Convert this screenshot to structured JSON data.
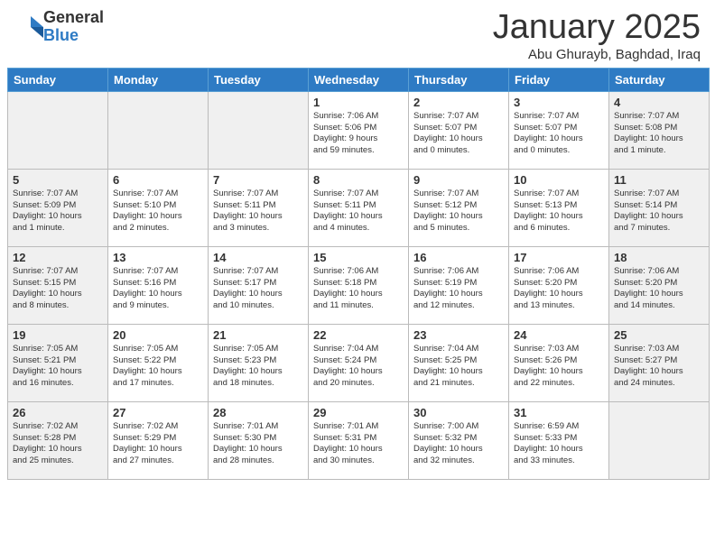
{
  "header": {
    "logo_general": "General",
    "logo_blue": "Blue",
    "month_title": "January 2025",
    "location": "Abu Ghurayb, Baghdad, Iraq"
  },
  "days_of_week": [
    "Sunday",
    "Monday",
    "Tuesday",
    "Wednesday",
    "Thursday",
    "Friday",
    "Saturday"
  ],
  "weeks": [
    [
      {
        "day": "",
        "info": ""
      },
      {
        "day": "",
        "info": ""
      },
      {
        "day": "",
        "info": ""
      },
      {
        "day": "1",
        "info": "Sunrise: 7:06 AM\nSunset: 5:06 PM\nDaylight: 9 hours\nand 59 minutes."
      },
      {
        "day": "2",
        "info": "Sunrise: 7:07 AM\nSunset: 5:07 PM\nDaylight: 10 hours\nand 0 minutes."
      },
      {
        "day": "3",
        "info": "Sunrise: 7:07 AM\nSunset: 5:07 PM\nDaylight: 10 hours\nand 0 minutes."
      },
      {
        "day": "4",
        "info": "Sunrise: 7:07 AM\nSunset: 5:08 PM\nDaylight: 10 hours\nand 1 minute."
      }
    ],
    [
      {
        "day": "5",
        "info": "Sunrise: 7:07 AM\nSunset: 5:09 PM\nDaylight: 10 hours\nand 1 minute."
      },
      {
        "day": "6",
        "info": "Sunrise: 7:07 AM\nSunset: 5:10 PM\nDaylight: 10 hours\nand 2 minutes."
      },
      {
        "day": "7",
        "info": "Sunrise: 7:07 AM\nSunset: 5:11 PM\nDaylight: 10 hours\nand 3 minutes."
      },
      {
        "day": "8",
        "info": "Sunrise: 7:07 AM\nSunset: 5:11 PM\nDaylight: 10 hours\nand 4 minutes."
      },
      {
        "day": "9",
        "info": "Sunrise: 7:07 AM\nSunset: 5:12 PM\nDaylight: 10 hours\nand 5 minutes."
      },
      {
        "day": "10",
        "info": "Sunrise: 7:07 AM\nSunset: 5:13 PM\nDaylight: 10 hours\nand 6 minutes."
      },
      {
        "day": "11",
        "info": "Sunrise: 7:07 AM\nSunset: 5:14 PM\nDaylight: 10 hours\nand 7 minutes."
      }
    ],
    [
      {
        "day": "12",
        "info": "Sunrise: 7:07 AM\nSunset: 5:15 PM\nDaylight: 10 hours\nand 8 minutes."
      },
      {
        "day": "13",
        "info": "Sunrise: 7:07 AM\nSunset: 5:16 PM\nDaylight: 10 hours\nand 9 minutes."
      },
      {
        "day": "14",
        "info": "Sunrise: 7:07 AM\nSunset: 5:17 PM\nDaylight: 10 hours\nand 10 minutes."
      },
      {
        "day": "15",
        "info": "Sunrise: 7:06 AM\nSunset: 5:18 PM\nDaylight: 10 hours\nand 11 minutes."
      },
      {
        "day": "16",
        "info": "Sunrise: 7:06 AM\nSunset: 5:19 PM\nDaylight: 10 hours\nand 12 minutes."
      },
      {
        "day": "17",
        "info": "Sunrise: 7:06 AM\nSunset: 5:20 PM\nDaylight: 10 hours\nand 13 minutes."
      },
      {
        "day": "18",
        "info": "Sunrise: 7:06 AM\nSunset: 5:20 PM\nDaylight: 10 hours\nand 14 minutes."
      }
    ],
    [
      {
        "day": "19",
        "info": "Sunrise: 7:05 AM\nSunset: 5:21 PM\nDaylight: 10 hours\nand 16 minutes."
      },
      {
        "day": "20",
        "info": "Sunrise: 7:05 AM\nSunset: 5:22 PM\nDaylight: 10 hours\nand 17 minutes."
      },
      {
        "day": "21",
        "info": "Sunrise: 7:05 AM\nSunset: 5:23 PM\nDaylight: 10 hours\nand 18 minutes."
      },
      {
        "day": "22",
        "info": "Sunrise: 7:04 AM\nSunset: 5:24 PM\nDaylight: 10 hours\nand 20 minutes."
      },
      {
        "day": "23",
        "info": "Sunrise: 7:04 AM\nSunset: 5:25 PM\nDaylight: 10 hours\nand 21 minutes."
      },
      {
        "day": "24",
        "info": "Sunrise: 7:03 AM\nSunset: 5:26 PM\nDaylight: 10 hours\nand 22 minutes."
      },
      {
        "day": "25",
        "info": "Sunrise: 7:03 AM\nSunset: 5:27 PM\nDaylight: 10 hours\nand 24 minutes."
      }
    ],
    [
      {
        "day": "26",
        "info": "Sunrise: 7:02 AM\nSunset: 5:28 PM\nDaylight: 10 hours\nand 25 minutes."
      },
      {
        "day": "27",
        "info": "Sunrise: 7:02 AM\nSunset: 5:29 PM\nDaylight: 10 hours\nand 27 minutes."
      },
      {
        "day": "28",
        "info": "Sunrise: 7:01 AM\nSunset: 5:30 PM\nDaylight: 10 hours\nand 28 minutes."
      },
      {
        "day": "29",
        "info": "Sunrise: 7:01 AM\nSunset: 5:31 PM\nDaylight: 10 hours\nand 30 minutes."
      },
      {
        "day": "30",
        "info": "Sunrise: 7:00 AM\nSunset: 5:32 PM\nDaylight: 10 hours\nand 32 minutes."
      },
      {
        "day": "31",
        "info": "Sunrise: 6:59 AM\nSunset: 5:33 PM\nDaylight: 10 hours\nand 33 minutes."
      },
      {
        "day": "",
        "info": ""
      }
    ]
  ]
}
